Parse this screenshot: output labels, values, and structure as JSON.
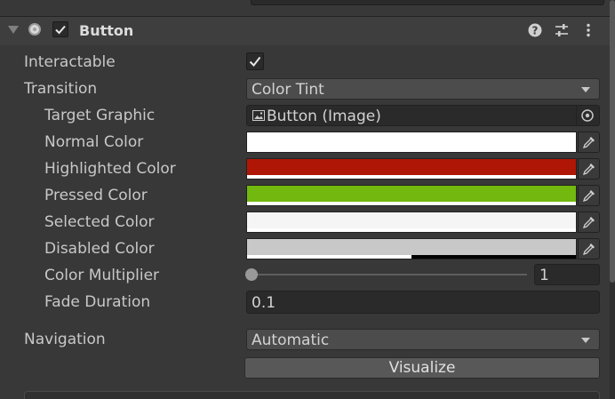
{
  "component": {
    "title": "Button",
    "enabled": true,
    "icons": [
      "component-icon",
      "help-icon",
      "preset-icon",
      "more-menu-icon"
    ]
  },
  "fields": {
    "interactable_label": "Interactable",
    "interactable_value": true,
    "transition_label": "Transition",
    "transition_value": "Color Tint",
    "target_graphic_label": "Target Graphic",
    "target_graphic_value": "Button (Image)",
    "normal_color_label": "Normal Color",
    "highlighted_color_label": "Highlighted Color",
    "pressed_color_label": "Pressed Color",
    "selected_color_label": "Selected Color",
    "disabled_color_label": "Disabled Color",
    "color_multiplier_label": "Color Multiplier",
    "color_multiplier_value": "1",
    "color_multiplier_fraction": 0.0,
    "fade_duration_label": "Fade Duration",
    "fade_duration_value": "0.1",
    "navigation_label": "Navigation",
    "navigation_value": "Automatic",
    "visualize_label": "Visualize"
  },
  "colors": {
    "normal": "#ffffff",
    "normal_alpha": 1.0,
    "highlighted": "#b01605",
    "highlighted_alpha": 1.0,
    "pressed": "#72b80f",
    "pressed_alpha": 1.0,
    "selected": "#f5f5f5",
    "selected_alpha": 1.0,
    "disabled": "#c8c8c8",
    "disabled_alpha": 0.5
  }
}
